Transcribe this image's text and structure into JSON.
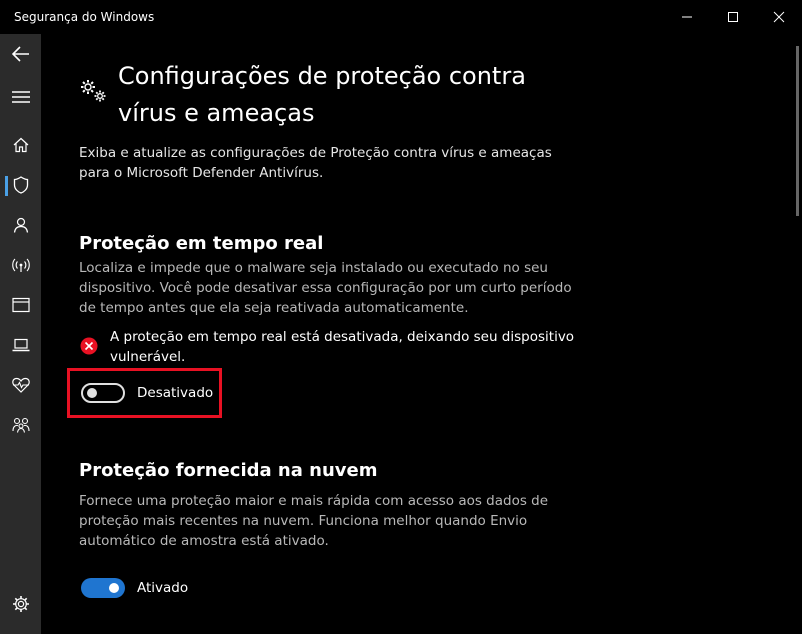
{
  "window": {
    "title": "Segurança do Windows"
  },
  "sidebar": {
    "items": [
      {
        "icon": "back-arrow-icon"
      },
      {
        "icon": "hamburger-menu-icon"
      },
      {
        "icon": "home-icon"
      },
      {
        "icon": "shield-icon",
        "active": true
      },
      {
        "icon": "person-icon"
      },
      {
        "icon": "wireless-icon"
      },
      {
        "icon": "app-browser-icon"
      },
      {
        "icon": "laptop-icon"
      },
      {
        "icon": "heart-pulse-icon"
      },
      {
        "icon": "family-icon"
      },
      {
        "icon": "settings-gear-icon"
      }
    ]
  },
  "page": {
    "title": "Configurações de proteção contra vírus e ameaças",
    "description": "Exiba e atualize as configurações de Proteção contra vírus e ameaças para o Microsoft Defender Antivírus."
  },
  "realtime": {
    "title": "Proteção em tempo real",
    "description": "Localiza e impede que o malware seja instalado ou executado no seu dispositivo. Você pode desativar essa configuração por um curto período de tempo antes que ela seja reativada automaticamente.",
    "alert": "A proteção em tempo real está desativada, deixando seu dispositivo vulnerável.",
    "toggle_state": false,
    "toggle_label": "Desativado"
  },
  "cloud": {
    "title": "Proteção fornecida na nuvem",
    "description": "Fornece uma proteção maior e mais rápida com acesso aos dados de proteção mais recentes na nuvem. Funciona melhor quando Envio automático de amostra está ativado.",
    "toggle_state": true,
    "toggle_label": "Ativado"
  },
  "colors": {
    "accent": "#1f75d0",
    "highlight": "#e81123",
    "error": "#e81123",
    "sidebar_bg": "#2b2b2b"
  }
}
